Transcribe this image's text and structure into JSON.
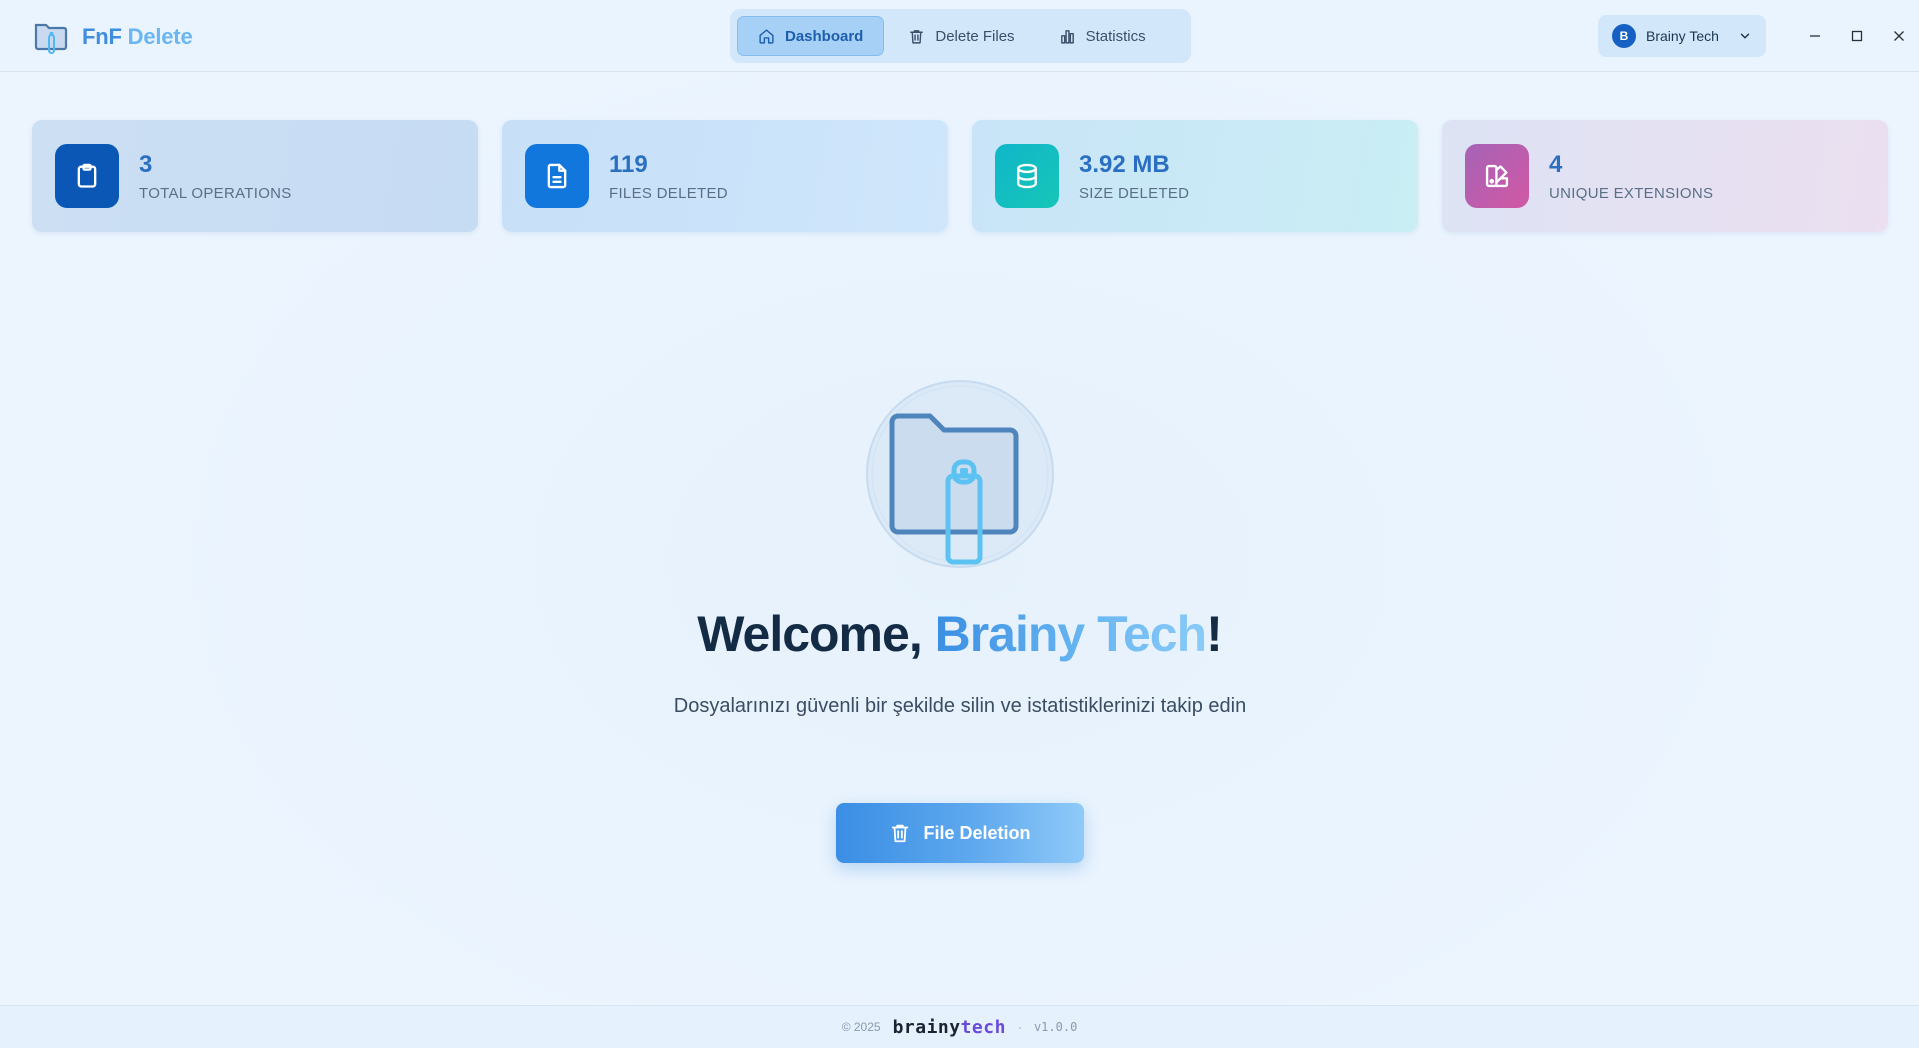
{
  "app": {
    "name_main": "FnF",
    "name_accent": "Delete"
  },
  "nav": {
    "tabs": [
      {
        "label": "Dashboard",
        "active": true,
        "icon": "home-icon"
      },
      {
        "label": "Delete Files",
        "active": false,
        "icon": "trash-icon"
      },
      {
        "label": "Statistics",
        "active": false,
        "icon": "bar-chart-icon"
      }
    ]
  },
  "user": {
    "initial": "B",
    "name": "Brainy Tech"
  },
  "stats": [
    {
      "value": "3",
      "label": "TOTAL OPERATIONS",
      "icon": "clipboard-icon",
      "color": "#0a57b5"
    },
    {
      "value": "119",
      "label": "FILES DELETED",
      "icon": "file-icon",
      "color": "#1277dc"
    },
    {
      "value": "3.92 MB",
      "label": "SIZE DELETED",
      "icon": "database-icon",
      "color": "#10b6c9"
    },
    {
      "value": "4",
      "label": "UNIQUE EXTENSIONS",
      "icon": "extensions-icon",
      "color": "#c25aa9"
    }
  ],
  "hero": {
    "welcome_prefix": "Welcome, ",
    "welcome_name": "Brainy Tech",
    "welcome_suffix": "!",
    "subtitle": "Dosyalarınızı güvenli bir şekilde silin ve istatistiklerinizi takip edin",
    "cta_label": "File Deletion"
  },
  "footer": {
    "copyright": "© 2025",
    "brand_main": "brainy",
    "brand_accent": "tech",
    "separator": "·",
    "version": "v1.0.0"
  }
}
